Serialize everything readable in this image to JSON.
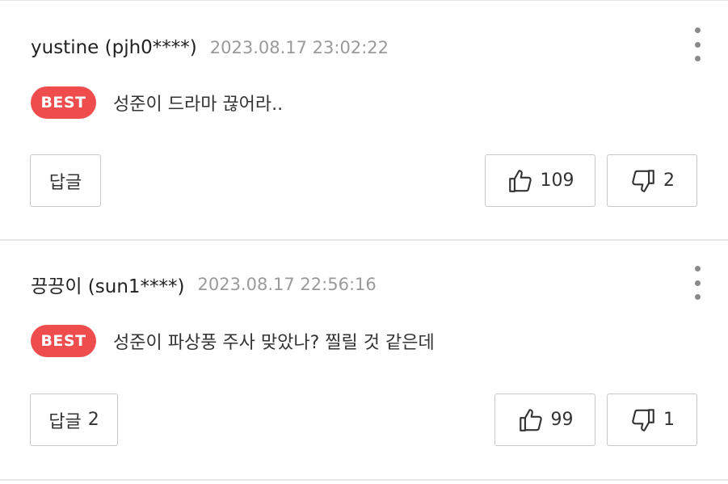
{
  "comments": [
    {
      "author": "yustine (pjh0****)",
      "timestamp": "2023.08.17 23:02:22",
      "badge": "BEST",
      "text": "성준이 드라마 끊어라..",
      "reply_label": "답글",
      "reply_count": "",
      "likes": "109",
      "dislikes": "2"
    },
    {
      "author": "끙끙이 (sun1****)",
      "timestamp": "2023.08.17 22:56:16",
      "badge": "BEST",
      "text": "성준이 파상풍 주사 맞았나? 찔릴 것 같은데",
      "reply_label": "답글",
      "reply_count": "2",
      "likes": "99",
      "dislikes": "1"
    }
  ],
  "icons": {
    "more": "more-vertical-icon",
    "like": "thumbs-up-icon",
    "dislike": "thumbs-down-icon"
  },
  "colors": {
    "badge": "#ef4d4d",
    "timestamp": "#9a9a9a",
    "border": "#c8c8c8"
  }
}
